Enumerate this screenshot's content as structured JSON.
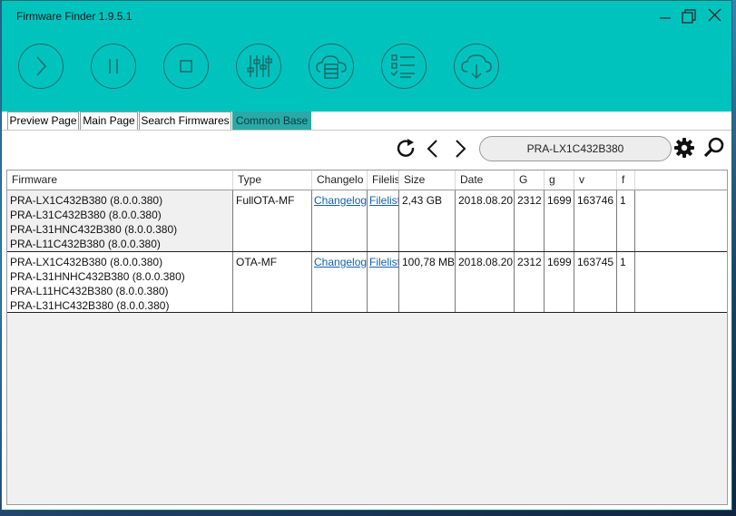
{
  "window": {
    "title": "Firmware Finder 1.9.5.1",
    "accent_color": "#00c3be"
  },
  "toolbar": {
    "buttons": [
      {
        "icon": "play-icon"
      },
      {
        "icon": "pause-icon"
      },
      {
        "icon": "stop-icon"
      },
      {
        "icon": "settings-sliders-icon"
      },
      {
        "icon": "cloud-server-icon"
      },
      {
        "icon": "checklist-icon"
      },
      {
        "icon": "cloud-download-icon"
      }
    ]
  },
  "tabs": [
    {
      "label": "Preview Page",
      "active": false
    },
    {
      "label": "Main Page",
      "active": false
    },
    {
      "label": "Search Firmwares",
      "active": false
    },
    {
      "label": "Common Base",
      "active": true
    }
  ],
  "search": {
    "value": "PRA-LX1C432B380"
  },
  "table": {
    "columns": [
      "Firmware",
      "Type",
      "Changelo",
      "Filelis",
      "Size",
      "Date",
      "G",
      "g",
      "v",
      "f"
    ],
    "rows": [
      {
        "firmware": [
          "PRA-LX1C432B380 (8.0.0.380)",
          "PRA-L31C432B380 (8.0.0.380)",
          "PRA-L31HNC432B380 (8.0.0.380)",
          "PRA-L11C432B380 (8.0.0.380)"
        ],
        "type": "FullOTA-MF",
        "changelog": "Changelog",
        "filelist": "Filelist",
        "size": "2,43 GB",
        "date": "2018.08.20",
        "G": "2312",
        "g": "1699",
        "v": "163746",
        "f": "1"
      },
      {
        "firmware": [
          "PRA-LX1C432B380 (8.0.0.380)",
          "PRA-L31HNHC432B380 (8.0.0.380)",
          "PRA-L11HC432B380 (8.0.0.380)",
          "PRA-L31HC432B380 (8.0.0.380)"
        ],
        "type": "OTA-MF",
        "changelog": "Changelog",
        "filelist": "Filelist",
        "size": "100,78 MB",
        "date": "2018.08.20",
        "G": "2312",
        "g": "1699",
        "v": "163745",
        "f": "1"
      }
    ]
  }
}
